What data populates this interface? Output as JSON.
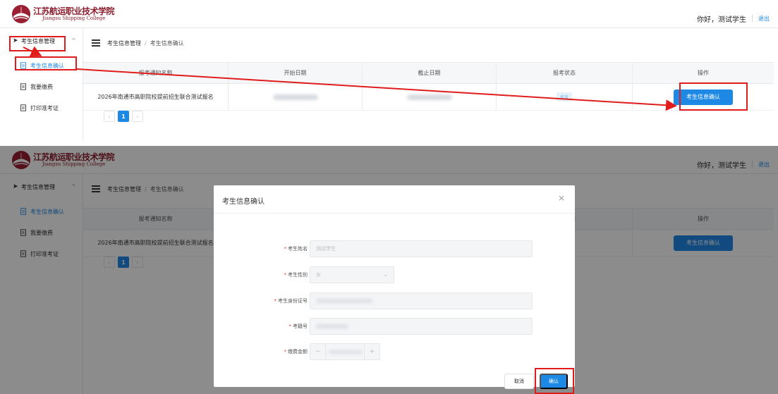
{
  "app": {
    "logo_text": "江苏航运职业技术学院",
    "logo_sub": "Jiangsu Shipping College",
    "greeting": "你好，测试学生",
    "logout": "退出"
  },
  "sidebar": {
    "group_label": "考生信息管理",
    "items": [
      {
        "label": "考生信息确认",
        "active": true
      },
      {
        "label": "我要缴费"
      },
      {
        "label": "打印准考证"
      }
    ]
  },
  "breadcrumb": {
    "root": "考生信息管理",
    "separator": "/",
    "current": "考生信息确认"
  },
  "table": {
    "headers": [
      "报考通知名称",
      "开始日期",
      "截止日期",
      "报考状态",
      "操作"
    ],
    "rows": [
      {
        "name": "2026年南通市高职院校提前招生联合测试报名",
        "status": "有效",
        "action": "考生信息确认"
      }
    ]
  },
  "pagination": {
    "prev": "‹",
    "current": "1",
    "next": "›"
  },
  "modal": {
    "title": "考生信息确认",
    "close": "×",
    "fields": [
      {
        "label": "考生姓名",
        "required": true,
        "value": "测试学生"
      },
      {
        "label": "考生性别",
        "required": true,
        "value": "女"
      },
      {
        "label": "考生身份证号",
        "required": true
      },
      {
        "label": "考籍号",
        "required": true
      },
      {
        "label": "缴费金额",
        "required": true
      }
    ],
    "required_mark": "*",
    "stepper_minus": "−",
    "stepper_plus": "+",
    "cancel": "取消",
    "confirm": "确认"
  },
  "colors": {
    "primary": "#1e88e5",
    "logo": "#8b1e2e",
    "annotation_red": "#e01c1c",
    "overlay": "rgba(0,0,0,0.45)"
  },
  "icons": {
    "logo": "college-logo-icon",
    "nav_group": "paper-plane-icon",
    "nav_item": "document-icon",
    "menu_toggle": "menu-icon",
    "select": "chevron-down-icon",
    "close": "close-icon"
  }
}
